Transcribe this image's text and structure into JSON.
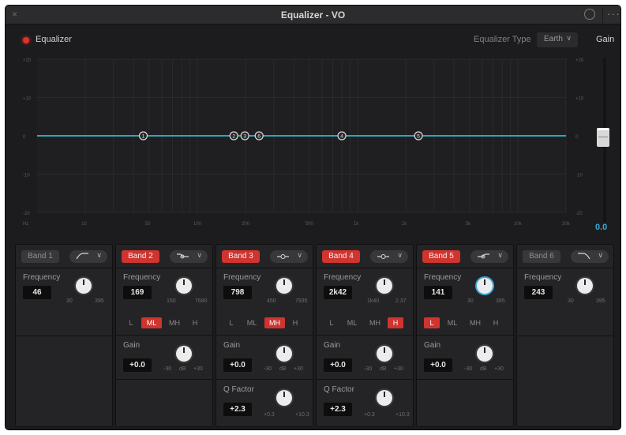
{
  "window": {
    "title": "Equalizer - VO",
    "close_symbol": "×",
    "more_symbol": "···"
  },
  "toolbar": {
    "equalizer_label": "Equalizer",
    "equalizer_type_label": "Equalizer Type",
    "equalizer_type_value": "Earth",
    "gain_label": "Gain",
    "gain_value": "0.0"
  },
  "colors": {
    "accent": "#3aa6d8",
    "band_on": "#d0342f",
    "curve": "#2aa8b8"
  },
  "graph": {
    "y_ticks_left": [
      "+20",
      "+10",
      "0",
      "-10",
      "-20"
    ],
    "y_ticks_right": [
      "+20",
      "+10",
      "0",
      "-10",
      "-20"
    ],
    "x_ticks": [
      "Hz",
      "10",
      "50",
      "100",
      "200",
      "500",
      "1k",
      "2k",
      "5k",
      "10k",
      "20k"
    ],
    "nodes": [
      {
        "label": "1",
        "freq": 46
      },
      {
        "label": "2",
        "freq": 169
      },
      {
        "label": "3",
        "freq": 198
      },
      {
        "label": "6",
        "freq": 243
      },
      {
        "label": "4",
        "freq": 798
      },
      {
        "label": "5",
        "freq": 2400
      }
    ]
  },
  "bands": [
    {
      "name": "Band 1",
      "enabled": false,
      "shape": "high-pass",
      "frequency_label": "Frequency",
      "frequency": "46",
      "freq_min": "30",
      "freq_max": "395"
    },
    {
      "name": "Band 2",
      "enabled": true,
      "shape": "low-shelf",
      "frequency_label": "Frequency",
      "frequency": "169",
      "freq_min": "150",
      "freq_max": "7680",
      "ranges": [
        {
          "label": "L",
          "on": false
        },
        {
          "label": "ML",
          "on": true
        },
        {
          "label": "MH",
          "on": false
        },
        {
          "label": "H",
          "on": false
        }
      ],
      "gain_label": "Gain",
      "gain": "+0.0",
      "gain_min": "-30",
      "gain_mid": "dB",
      "gain_max": "+30"
    },
    {
      "name": "Band 3",
      "enabled": true,
      "shape": "bell",
      "frequency_label": "Frequency",
      "frequency": "798",
      "freq_min": "450",
      "freq_max": "7935",
      "ranges": [
        {
          "label": "L",
          "on": false
        },
        {
          "label": "ML",
          "on": false
        },
        {
          "label": "MH",
          "on": true
        },
        {
          "label": "H",
          "on": false
        }
      ],
      "gain_label": "Gain",
      "gain": "+0.0",
      "gain_min": "-30",
      "gain_mid": "dB",
      "gain_max": "+30",
      "q_label": "Q Factor",
      "q": "+2.3",
      "q_min": "+0.3",
      "q_max": "+10.3"
    },
    {
      "name": "Band 4",
      "enabled": true,
      "shape": "bell",
      "frequency_label": "Frequency",
      "frequency": "2k42",
      "freq_min": "1k40",
      "freq_max": "2.37",
      "ranges": [
        {
          "label": "L",
          "on": false
        },
        {
          "label": "ML",
          "on": false
        },
        {
          "label": "MH",
          "on": false
        },
        {
          "label": "H",
          "on": true
        }
      ],
      "gain_label": "Gain",
      "gain": "+0.0",
      "gain_min": "-30",
      "gain_mid": "dB",
      "gain_max": "+30",
      "q_label": "Q Factor",
      "q": "+2.3",
      "q_min": "+0.3",
      "q_max": "+10.3"
    },
    {
      "name": "Band 5",
      "enabled": true,
      "shape": "high-shelf",
      "frequency_label": "Frequency",
      "frequency": "141",
      "freq_min": "30",
      "freq_max": "395",
      "ranges": [
        {
          "label": "L",
          "on": true
        },
        {
          "label": "ML",
          "on": false
        },
        {
          "label": "MH",
          "on": false
        },
        {
          "label": "H",
          "on": false
        }
      ],
      "gain_label": "Gain",
      "gain": "+0.0",
      "gain_min": "-30",
      "gain_mid": "dB",
      "gain_max": "+30"
    },
    {
      "name": "Band 6",
      "enabled": false,
      "shape": "low-pass",
      "frequency_label": "Frequency",
      "frequency": "243",
      "freq_min": "30",
      "freq_max": "395"
    }
  ]
}
